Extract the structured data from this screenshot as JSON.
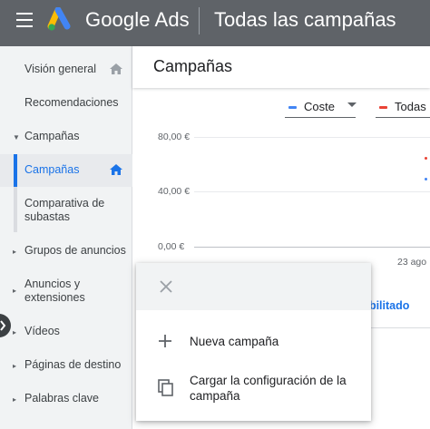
{
  "header": {
    "brand": "Google Ads",
    "page_title": "Todas las campañas",
    "colors": {
      "bar": "#5f6368",
      "logo_yellow": "#fbbc04",
      "logo_blue": "#4285f4",
      "logo_green": "#34a853"
    }
  },
  "sidebar": {
    "items": [
      {
        "label": "Visión general",
        "icon": "home-icon"
      },
      {
        "label": "Recomendaciones"
      },
      {
        "label": "Campañas",
        "expanded": true
      },
      {
        "label": "Campañas",
        "active": true,
        "icon": "home-icon"
      },
      {
        "label": "Comparativa de subastas"
      },
      {
        "label": "Grupos de anuncios"
      },
      {
        "label": "Anuncios y extensiones"
      },
      {
        "label": "Vídeos"
      },
      {
        "label": "Páginas de destino"
      },
      {
        "label": "Palabras clave"
      }
    ]
  },
  "main": {
    "title": "Campañas",
    "metrics": [
      {
        "label": "Coste",
        "color": "#4285f4"
      },
      {
        "label": "Todas",
        "color": "#ea4335"
      }
    ],
    "filter_link": "abilitado"
  },
  "chart_data": {
    "type": "line",
    "y_ticks": [
      "80,00 €",
      "40,00 €",
      "0,00 €"
    ],
    "x_ticks": [
      "23 ago"
    ],
    "series": [
      {
        "name": "Coste",
        "color": "#4285f4"
      },
      {
        "name": "Todas",
        "color": "#ea4335"
      }
    ]
  },
  "popup": {
    "items": [
      {
        "label": "Nueva campaña",
        "icon": "plus-icon"
      },
      {
        "label": "Cargar la configuración de la campaña",
        "icon": "copy-icon"
      }
    ]
  }
}
